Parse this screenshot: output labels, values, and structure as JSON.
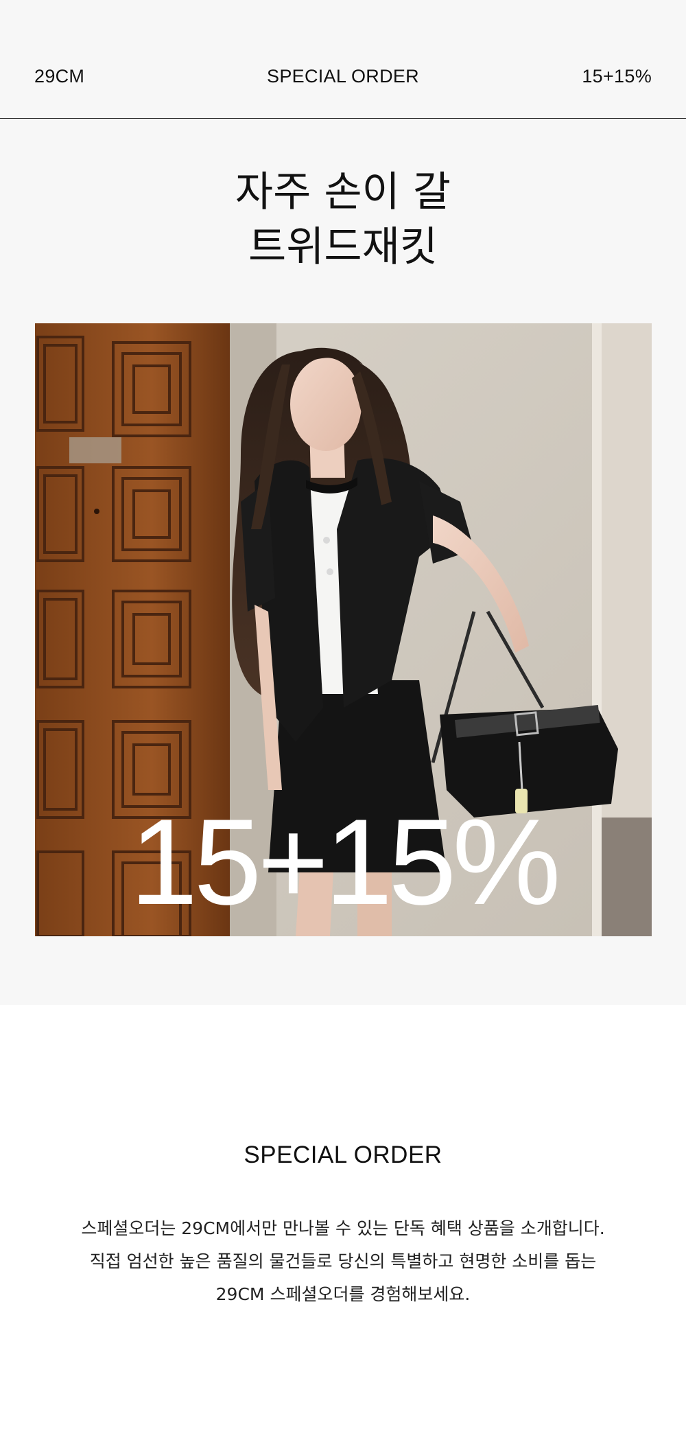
{
  "header": {
    "brand": "29CM",
    "title": "SPECIAL ORDER",
    "discount": "15+15%"
  },
  "headline": {
    "line1": "자주 손이 갈",
    "line2": "트위드재킷"
  },
  "hero": {
    "overlay_text": "15+15%",
    "image_description_icon": "model-photo-icon"
  },
  "intro": {
    "title": "SPECIAL ORDER",
    "lines": [
      "스페셜오더는 29CM에서만 만나볼 수 있는 단독 혜택 상품을 소개합니다.",
      "직접 엄선한 높은 품질의 물건들로 당신의 특별하고 현명한 소비를 돕는",
      "29CM 스페셜오더를 경험해보세요."
    ]
  },
  "colors": {
    "top_background": "#f7f7f7",
    "page_background": "#ffffff",
    "text": "#111111",
    "overlay_text": "#ffffff"
  }
}
